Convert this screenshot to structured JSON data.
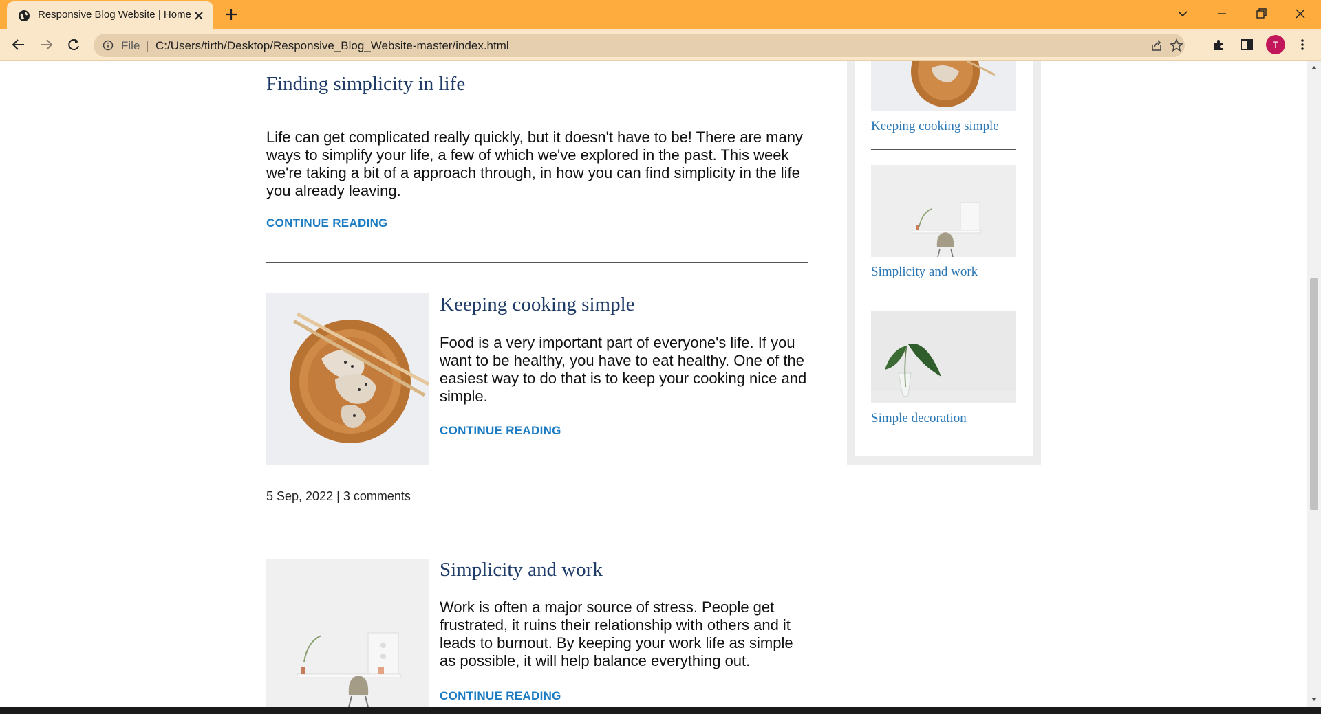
{
  "browser": {
    "tab_title": "Responsive Blog Website | Home",
    "scheme_label": "File",
    "separator": "|",
    "url": "C:/Users/tirth/Desktop/Responsive_Blog_Website-master/index.html",
    "profile_initial": "T",
    "accent": "#ffac3f",
    "toolbar_bg": "#fae6c8",
    "profile_color": "#c2185b"
  },
  "posts": [
    {
      "title": "Finding simplicity in life",
      "body": "Life can get complicated really quickly, but it doesn't have to be! There are many ways to simplify your life, a few of which we've explored in the past. This week we're taking a bit of a approach through, in how you can find simplicity in the life you already leaving.",
      "cta": "CONTINUE READING"
    },
    {
      "title": "Keeping cooking simple",
      "body": "Food is a very important part of everyone's life. If you want to be healthy, you have to eat healthy. One of the easiest way to do that is to keep your cooking nice and simple.",
      "cta": "CONTINUE READING",
      "image_icon": "dumplings-bowl-image",
      "date": "5 Sep, 2022",
      "meta_sep": "|",
      "comments": "3 comments"
    },
    {
      "title": "Simplicity and work",
      "body": "Work is often a major source of stress. People get frustrated, it ruins their relationship with others and it leads to burnout. By keeping your work life as simple as possible, it will help balance everything out.",
      "cta": "CONTINUE READING",
      "image_icon": "desk-chair-image"
    }
  ],
  "sidebar": {
    "items": [
      {
        "label": "Keeping cooking simple",
        "image_icon": "dumplings-bowl-image"
      },
      {
        "label": "Simplicity and work",
        "image_icon": "desk-chair-image"
      },
      {
        "label": "Simple decoration",
        "image_icon": "plant-vase-image"
      }
    ]
  },
  "colors": {
    "title": "#1f3c68",
    "link": "#1a7bc2",
    "sidebar_link": "#2a77b6"
  }
}
